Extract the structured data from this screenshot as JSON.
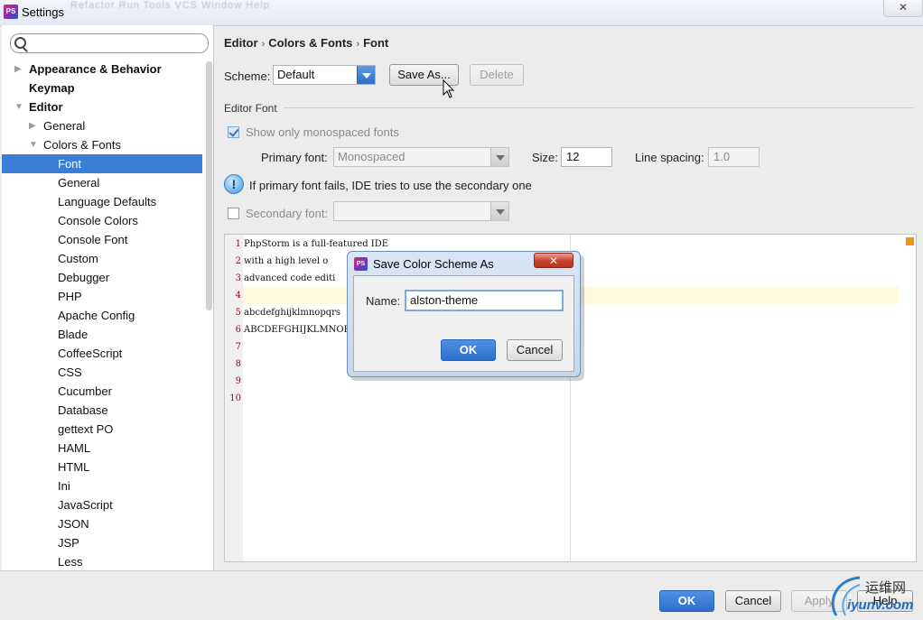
{
  "window": {
    "title": "Settings",
    "ghost_menu": "Refactor   Run   Tools   VCS   Window   Help",
    "close_glyph": "✕"
  },
  "search": {
    "placeholder": "",
    "value": ""
  },
  "tree": [
    {
      "label": "Appearance & Behavior",
      "level": 0,
      "arrow": "▶"
    },
    {
      "label": "Keymap",
      "level": 0,
      "arrow": ""
    },
    {
      "label": "Editor",
      "level": 0,
      "arrow": "▼"
    },
    {
      "label": "General",
      "level": 1,
      "arrow": "▶"
    },
    {
      "label": "Colors & Fonts",
      "level": 1,
      "arrow": "▼"
    },
    {
      "label": "Font",
      "level": 2,
      "arrow": "",
      "selected": true
    },
    {
      "label": "General",
      "level": 2,
      "arrow": ""
    },
    {
      "label": "Language Defaults",
      "level": 2,
      "arrow": ""
    },
    {
      "label": "Console Colors",
      "level": 2,
      "arrow": ""
    },
    {
      "label": "Console Font",
      "level": 2,
      "arrow": ""
    },
    {
      "label": "Custom",
      "level": 2,
      "arrow": ""
    },
    {
      "label": "Debugger",
      "level": 2,
      "arrow": ""
    },
    {
      "label": "PHP",
      "level": 2,
      "arrow": ""
    },
    {
      "label": "Apache Config",
      "level": 2,
      "arrow": ""
    },
    {
      "label": "Blade",
      "level": 2,
      "arrow": ""
    },
    {
      "label": "CoffeeScript",
      "level": 2,
      "arrow": ""
    },
    {
      "label": "CSS",
      "level": 2,
      "arrow": ""
    },
    {
      "label": "Cucumber",
      "level": 2,
      "arrow": ""
    },
    {
      "label": "Database",
      "level": 2,
      "arrow": ""
    },
    {
      "label": "gettext PO",
      "level": 2,
      "arrow": ""
    },
    {
      "label": "HAML",
      "level": 2,
      "arrow": ""
    },
    {
      "label": "HTML",
      "level": 2,
      "arrow": ""
    },
    {
      "label": "Ini",
      "level": 2,
      "arrow": ""
    },
    {
      "label": "JavaScript",
      "level": 2,
      "arrow": ""
    },
    {
      "label": "JSON",
      "level": 2,
      "arrow": ""
    },
    {
      "label": "JSP",
      "level": 2,
      "arrow": ""
    },
    {
      "label": "Less",
      "level": 2,
      "arrow": ""
    }
  ],
  "breadcrumb": [
    "Editor",
    "Colors & Fonts",
    "Font"
  ],
  "breadcrumb_sep": "›",
  "scheme": {
    "label": "Scheme:",
    "value": "Default",
    "save_as": "Save As...",
    "delete": "Delete"
  },
  "editor_font": {
    "section_title": "Editor Font",
    "monospaced_label": "Show only monospaced fonts",
    "monospaced_checked": true,
    "primary_label": "Primary font:",
    "primary_value": "Monospaced",
    "size_label": "Size:",
    "size_value": "12",
    "spacing_label": "Line spacing:",
    "spacing_value": "1.0",
    "info_glyph": "!",
    "info_text": "If primary font fails, IDE tries to use the secondary one",
    "secondary_label": "Secondary font:",
    "secondary_checked": false,
    "secondary_value": ""
  },
  "preview": {
    "lines": [
      {
        "num": "1",
        "text": "PhpStorm is a full-featured IDE"
      },
      {
        "num": "2",
        "text": "with a high level o"
      },
      {
        "num": "3",
        "text": "advanced code editi"
      },
      {
        "num": "4",
        "text": ""
      },
      {
        "num": "5",
        "text": "abcdefghijklmnopqrs"
      },
      {
        "num": "6",
        "text": "ABCDEFGHIJKLMNOPQRS"
      },
      {
        "num": "7",
        "text": ""
      },
      {
        "num": "8",
        "text": ""
      },
      {
        "num": "9",
        "text": ""
      },
      {
        "num": "10",
        "text": ""
      }
    ]
  },
  "dialog": {
    "title": "Save Color Scheme As",
    "close_glyph": "✕",
    "name_label": "Name:",
    "name_value": "alston-theme",
    "ok": "OK",
    "cancel": "Cancel",
    "icon_text": "PS"
  },
  "footer": {
    "ok": "OK",
    "cancel": "Cancel",
    "apply": "Apply",
    "help": "Help"
  },
  "app_icon_text": "PS",
  "watermark": {
    "text": "运维网",
    "sub": "iyunv.com"
  },
  "colors": {
    "accent": "#3b7ed7",
    "primary_button": "#2e6fcc",
    "line_numbers": "#b0001f",
    "caret_row": "#fff8dc"
  }
}
